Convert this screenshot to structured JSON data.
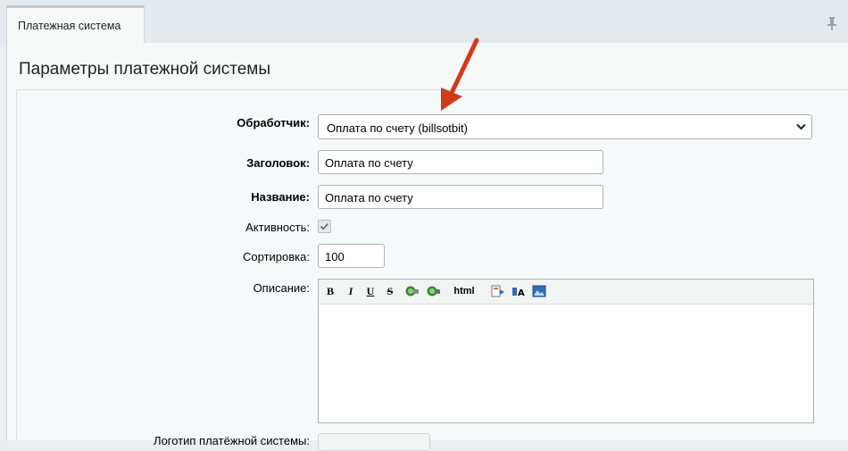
{
  "tabs": [
    {
      "label": "Платежная система"
    }
  ],
  "page": {
    "title": "Параметры платежной системы"
  },
  "form": {
    "handler": {
      "label": "Обработчик:",
      "value": "Оплата по счету (billsotbit)"
    },
    "heading": {
      "label": "Заголовок:",
      "value": "Оплата по счету"
    },
    "name": {
      "label": "Название:",
      "value": "Оплата по счету"
    },
    "active": {
      "label": "Активность:",
      "checked": true
    },
    "sort": {
      "label": "Сортировка:",
      "value": "100"
    },
    "description": {
      "label": "Описание:",
      "toolbar": {
        "bold": "B",
        "italic": "I",
        "underline": "U",
        "strike": "S",
        "html": "html"
      }
    },
    "logo": {
      "label": "Логотип платёжной системы:"
    }
  },
  "icons": {
    "pin": "pin-icon",
    "arrow": "annotation-arrow-icon"
  },
  "colors": {
    "arrow": "#d03a1b",
    "background": "#e9eef0",
    "panel": "#f7f9f9"
  }
}
